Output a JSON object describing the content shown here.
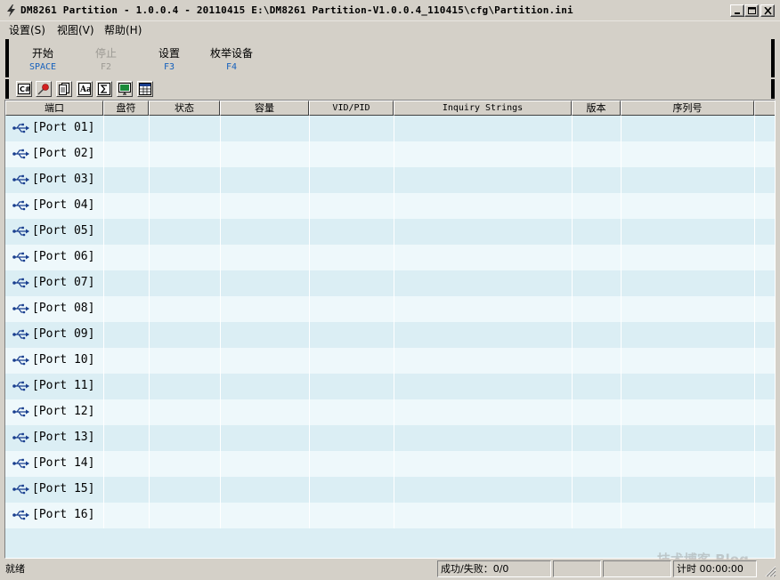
{
  "window": {
    "title": "DM8261 Partition - 1.0.0.4 - 20110415  E:\\DM8261 Partition-V1.0.0.4_110415\\cfg\\Partition.ini"
  },
  "menu": {
    "items": [
      {
        "label": "设置(S)"
      },
      {
        "label": "视图(V)"
      },
      {
        "label": "帮助(H)"
      }
    ]
  },
  "commands": [
    {
      "label": "开始",
      "key": "SPACE",
      "enabled": true
    },
    {
      "label": "停止",
      "key": "F2",
      "enabled": false
    },
    {
      "label": "设置",
      "key": "F3",
      "enabled": true
    },
    {
      "label": "枚举设备",
      "key": "F4",
      "enabled": true
    }
  ],
  "toolbar_icons": [
    "cd-icon",
    "pin-icon",
    "document-icon",
    "font-icon",
    "sigma-icon",
    "monitor-icon",
    "grid-icon"
  ],
  "columns": [
    "端口",
    "盘符",
    "状态",
    "容量",
    "VID/PID",
    "Inquiry Strings",
    "版本",
    "序列号"
  ],
  "ports": [
    {
      "name": "[Port 01]"
    },
    {
      "name": "[Port 02]"
    },
    {
      "name": "[Port 03]"
    },
    {
      "name": "[Port 04]"
    },
    {
      "name": "[Port 05]"
    },
    {
      "name": "[Port 06]"
    },
    {
      "name": "[Port 07]"
    },
    {
      "name": "[Port 08]"
    },
    {
      "name": "[Port 09]"
    },
    {
      "name": "[Port 10]"
    },
    {
      "name": "[Port 11]"
    },
    {
      "name": "[Port 12]"
    },
    {
      "name": "[Port 13]"
    },
    {
      "name": "[Port 14]"
    },
    {
      "name": "[Port 15]"
    },
    {
      "name": "[Port 16]"
    }
  ],
  "status": {
    "ready": "就绪",
    "result": "成功/失败：0/0",
    "timer": "计时 00:00:00"
  },
  "watermark": "技术博客  Blog",
  "colors": {
    "list_bg": "#dbeef4",
    "list_alt": "#eef8fb",
    "key_accent": "#1560bd",
    "usb_icon": "#1a3f8f"
  }
}
